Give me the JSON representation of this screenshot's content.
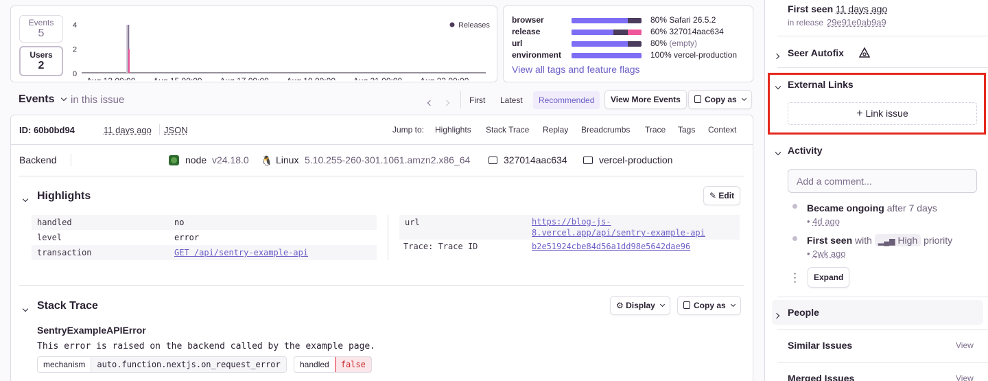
{
  "stats": {
    "events_label": "Events",
    "events_value": "5",
    "users_label": "Users",
    "users_value": "2"
  },
  "trend_chart": {
    "legend": "Releases",
    "y_ticks": [
      "4",
      "2",
      "0"
    ],
    "x_ticks": [
      "Aug 13 00:00",
      "Aug 15 00:00",
      "Aug 17 00:00",
      "Aug 19 00:00",
      "Aug 21 00:00",
      "Aug 23 00:00"
    ]
  },
  "chart_data": {
    "type": "bar",
    "categories": [
      "Aug 13 00:00"
    ],
    "series": [
      {
        "values": [
          2
        ]
      }
    ],
    "ylim": [
      0,
      4
    ],
    "ylabel": "",
    "legend": "Releases"
  },
  "tags": [
    {
      "key": "browser",
      "pct": 80,
      "text": "80% Safari 26.5.2",
      "muted": ""
    },
    {
      "key": "release",
      "pct": 60,
      "text": "60% 327014aac634",
      "muted": ""
    },
    {
      "key": "url",
      "pct": 80,
      "text": "80%",
      "muted": "(empty)"
    },
    {
      "key": "environment",
      "pct": 100,
      "text": "100% vercel-production",
      "muted": ""
    }
  ],
  "tags_link": "View all tags and feature flags",
  "events_header": {
    "title": "Events",
    "subtitle": "in this issue",
    "nav": [
      "First",
      "Latest",
      "Recommended"
    ],
    "view_more": "View More Events",
    "copy_as": "Copy as"
  },
  "event": {
    "id": "ID: 60b0bd94",
    "time": "11 days ago",
    "json": "JSON",
    "jump_label": "Jump to:",
    "jump_links": [
      "Highlights",
      "Stack Trace",
      "Replay",
      "Breadcrumbs",
      "Trace",
      "Tags",
      "Context"
    ],
    "context_label": "Backend",
    "runtime": "node",
    "runtime_ver": "v24.18.0",
    "os": "Linux",
    "os_ver": "5.10.255-260-301.1061.amzn2.x86_64",
    "release": "327014aac634",
    "environment": "vercel-production"
  },
  "highlights": {
    "title": "Highlights",
    "edit": "Edit",
    "left": [
      {
        "k": "handled",
        "v": "no",
        "link": false
      },
      {
        "k": "level",
        "v": "error",
        "link": false
      },
      {
        "k": "transaction",
        "v": "GET /api/sentry-example-api",
        "link": true
      }
    ],
    "right_url_key": "url",
    "right_url_line1": "https://blog-js-",
    "right_url_line2": "8.vercel.app/api/sentry-example-api",
    "right_trace_key": "Trace: Trace ID",
    "right_trace_val": "b2e51924cbe84d56a1dd98e5642dae96"
  },
  "stack": {
    "title": "Stack Trace",
    "display": "Display",
    "copy_as": "Copy as",
    "error_type": "SentryExampleAPIError",
    "message": "This error is raised on the backend called by the example page.",
    "mech_label": "mechanism",
    "mech_value": "auto.function.nextjs.on_request_error",
    "handled_label": "handled",
    "handled_value": "false"
  },
  "sidebar": {
    "first_seen_label": "First seen",
    "first_seen_time": "11 days ago",
    "in_release_label": "in release",
    "release": "29e91e0ab9a9",
    "seer": "Seer Autofix",
    "external_links": "External Links",
    "link_issue": "Link issue",
    "activity": "Activity",
    "comment_placeholder": "Add a comment...",
    "act1_bold": "Became ongoing",
    "act1_rest": "after 7 days",
    "act1_time": "4d ago",
    "act2_bold": "First seen",
    "act2_with": "with",
    "act2_badge": "High",
    "act2_rest": "priority",
    "act2_time": "2wk ago",
    "expand": "Expand",
    "people": "People",
    "similar": "Similar Issues",
    "similar_view": "View",
    "merged": "Merged Issues",
    "merged_view": "View"
  },
  "colors": {
    "accent": "#6c5fc7",
    "bar": "#7e6ef5",
    "pink": "#f0579b",
    "dark": "#4b3b5c",
    "highlight_box": "#e5281f"
  }
}
